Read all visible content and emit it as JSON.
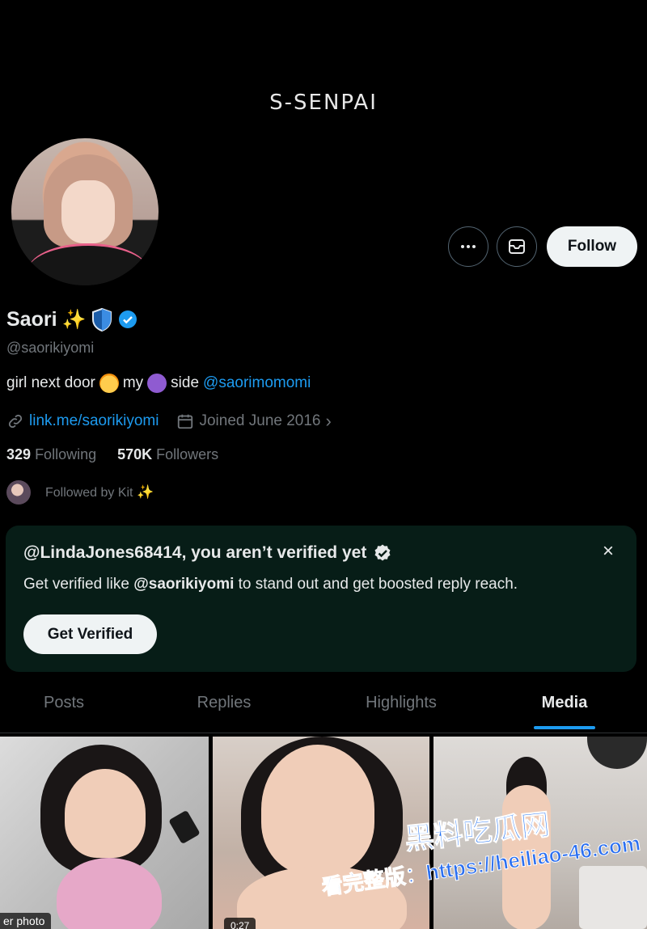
{
  "banner": {
    "title": "S-SENPAI"
  },
  "header_actions": {
    "follow_label": "Follow"
  },
  "profile": {
    "display_name": "Saori",
    "name_sparkle": "✨",
    "handle": "@saorikiyomi",
    "bio": {
      "part1": "girl next door",
      "part2": "my",
      "part3": "side",
      "mention": "@saorimomomi"
    },
    "link": "link.me/saorikiyomi",
    "joined": "Joined June 2016",
    "following_count": "329",
    "following_label": "Following",
    "followers_count": "570K",
    "followers_label": "Followers",
    "followed_by": "Followed by Kit",
    "followed_by_sparkle": "✨"
  },
  "verify_card": {
    "title": "@LindaJones68414, you aren’t verified yet",
    "sub_prefix": "Get verified like ",
    "sub_handle": "@saorikiyomi",
    "sub_suffix": " to stand out and get boosted reply reach.",
    "button": "Get Verified",
    "close": "×"
  },
  "tabs": [
    {
      "label": "Posts"
    },
    {
      "label": "Replies"
    },
    {
      "label": "Highlights"
    },
    {
      "label": "Media"
    }
  ],
  "media": {
    "tile1_label": "er photo",
    "tile2_duration": "0:27"
  },
  "watermark": {
    "logo": "黑料吃瓜网",
    "url": "看完整版：https://heiliao-46.com"
  },
  "colors": {
    "accent": "#1d9bf0",
    "background": "#000000",
    "card_bg": "#071d17",
    "muted": "#71767b"
  }
}
